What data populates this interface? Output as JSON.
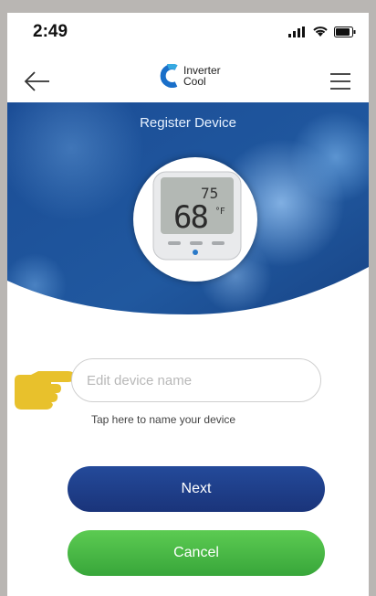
{
  "status_bar": {
    "time": "2:49"
  },
  "header": {
    "logo_line1": "Inverter",
    "logo_line2": "Cool"
  },
  "hero": {
    "title": "Register Device",
    "device_temp_small": "75",
    "device_temp_large": "68",
    "device_unit": "°F"
  },
  "form": {
    "device_name_placeholder": "Edit device name",
    "device_name_value": "",
    "hint": "Tap here to name your device"
  },
  "buttons": {
    "next_label": "Next",
    "cancel_label": "Cancel"
  },
  "colors": {
    "hero_blue": "#1e4f9c",
    "next_button": "#1f3f8a",
    "cancel_button": "#44b043",
    "pointer_hand": "#e9c22a"
  }
}
